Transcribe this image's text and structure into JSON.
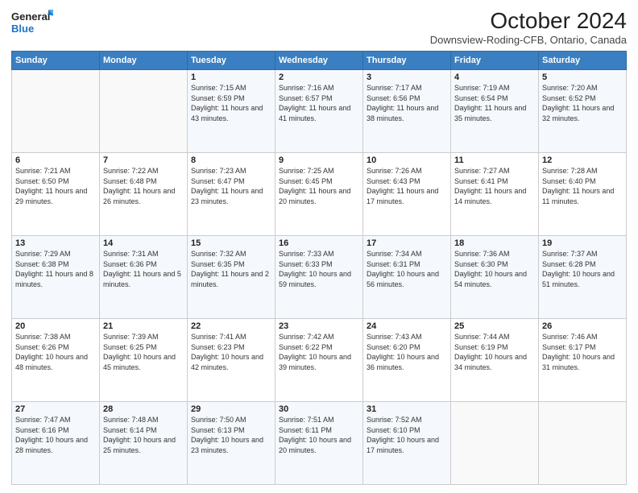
{
  "logo": {
    "line1": "General",
    "line2": "Blue"
  },
  "title": "October 2024",
  "subtitle": "Downsview-Roding-CFB, Ontario, Canada",
  "weekdays": [
    "Sunday",
    "Monday",
    "Tuesday",
    "Wednesday",
    "Thursday",
    "Friday",
    "Saturday"
  ],
  "weeks": [
    [
      {
        "day": "",
        "info": ""
      },
      {
        "day": "",
        "info": ""
      },
      {
        "day": "1",
        "info": "Sunrise: 7:15 AM\nSunset: 6:59 PM\nDaylight: 11 hours and 43 minutes."
      },
      {
        "day": "2",
        "info": "Sunrise: 7:16 AM\nSunset: 6:57 PM\nDaylight: 11 hours and 41 minutes."
      },
      {
        "day": "3",
        "info": "Sunrise: 7:17 AM\nSunset: 6:56 PM\nDaylight: 11 hours and 38 minutes."
      },
      {
        "day": "4",
        "info": "Sunrise: 7:19 AM\nSunset: 6:54 PM\nDaylight: 11 hours and 35 minutes."
      },
      {
        "day": "5",
        "info": "Sunrise: 7:20 AM\nSunset: 6:52 PM\nDaylight: 11 hours and 32 minutes."
      }
    ],
    [
      {
        "day": "6",
        "info": "Sunrise: 7:21 AM\nSunset: 6:50 PM\nDaylight: 11 hours and 29 minutes."
      },
      {
        "day": "7",
        "info": "Sunrise: 7:22 AM\nSunset: 6:48 PM\nDaylight: 11 hours and 26 minutes."
      },
      {
        "day": "8",
        "info": "Sunrise: 7:23 AM\nSunset: 6:47 PM\nDaylight: 11 hours and 23 minutes."
      },
      {
        "day": "9",
        "info": "Sunrise: 7:25 AM\nSunset: 6:45 PM\nDaylight: 11 hours and 20 minutes."
      },
      {
        "day": "10",
        "info": "Sunrise: 7:26 AM\nSunset: 6:43 PM\nDaylight: 11 hours and 17 minutes."
      },
      {
        "day": "11",
        "info": "Sunrise: 7:27 AM\nSunset: 6:41 PM\nDaylight: 11 hours and 14 minutes."
      },
      {
        "day": "12",
        "info": "Sunrise: 7:28 AM\nSunset: 6:40 PM\nDaylight: 11 hours and 11 minutes."
      }
    ],
    [
      {
        "day": "13",
        "info": "Sunrise: 7:29 AM\nSunset: 6:38 PM\nDaylight: 11 hours and 8 minutes."
      },
      {
        "day": "14",
        "info": "Sunrise: 7:31 AM\nSunset: 6:36 PM\nDaylight: 11 hours and 5 minutes."
      },
      {
        "day": "15",
        "info": "Sunrise: 7:32 AM\nSunset: 6:35 PM\nDaylight: 11 hours and 2 minutes."
      },
      {
        "day": "16",
        "info": "Sunrise: 7:33 AM\nSunset: 6:33 PM\nDaylight: 10 hours and 59 minutes."
      },
      {
        "day": "17",
        "info": "Sunrise: 7:34 AM\nSunset: 6:31 PM\nDaylight: 10 hours and 56 minutes."
      },
      {
        "day": "18",
        "info": "Sunrise: 7:36 AM\nSunset: 6:30 PM\nDaylight: 10 hours and 54 minutes."
      },
      {
        "day": "19",
        "info": "Sunrise: 7:37 AM\nSunset: 6:28 PM\nDaylight: 10 hours and 51 minutes."
      }
    ],
    [
      {
        "day": "20",
        "info": "Sunrise: 7:38 AM\nSunset: 6:26 PM\nDaylight: 10 hours and 48 minutes."
      },
      {
        "day": "21",
        "info": "Sunrise: 7:39 AM\nSunset: 6:25 PM\nDaylight: 10 hours and 45 minutes."
      },
      {
        "day": "22",
        "info": "Sunrise: 7:41 AM\nSunset: 6:23 PM\nDaylight: 10 hours and 42 minutes."
      },
      {
        "day": "23",
        "info": "Sunrise: 7:42 AM\nSunset: 6:22 PM\nDaylight: 10 hours and 39 minutes."
      },
      {
        "day": "24",
        "info": "Sunrise: 7:43 AM\nSunset: 6:20 PM\nDaylight: 10 hours and 36 minutes."
      },
      {
        "day": "25",
        "info": "Sunrise: 7:44 AM\nSunset: 6:19 PM\nDaylight: 10 hours and 34 minutes."
      },
      {
        "day": "26",
        "info": "Sunrise: 7:46 AM\nSunset: 6:17 PM\nDaylight: 10 hours and 31 minutes."
      }
    ],
    [
      {
        "day": "27",
        "info": "Sunrise: 7:47 AM\nSunset: 6:16 PM\nDaylight: 10 hours and 28 minutes."
      },
      {
        "day": "28",
        "info": "Sunrise: 7:48 AM\nSunset: 6:14 PM\nDaylight: 10 hours and 25 minutes."
      },
      {
        "day": "29",
        "info": "Sunrise: 7:50 AM\nSunset: 6:13 PM\nDaylight: 10 hours and 23 minutes."
      },
      {
        "day": "30",
        "info": "Sunrise: 7:51 AM\nSunset: 6:11 PM\nDaylight: 10 hours and 20 minutes."
      },
      {
        "day": "31",
        "info": "Sunrise: 7:52 AM\nSunset: 6:10 PM\nDaylight: 10 hours and 17 minutes."
      },
      {
        "day": "",
        "info": ""
      },
      {
        "day": "",
        "info": ""
      }
    ]
  ]
}
